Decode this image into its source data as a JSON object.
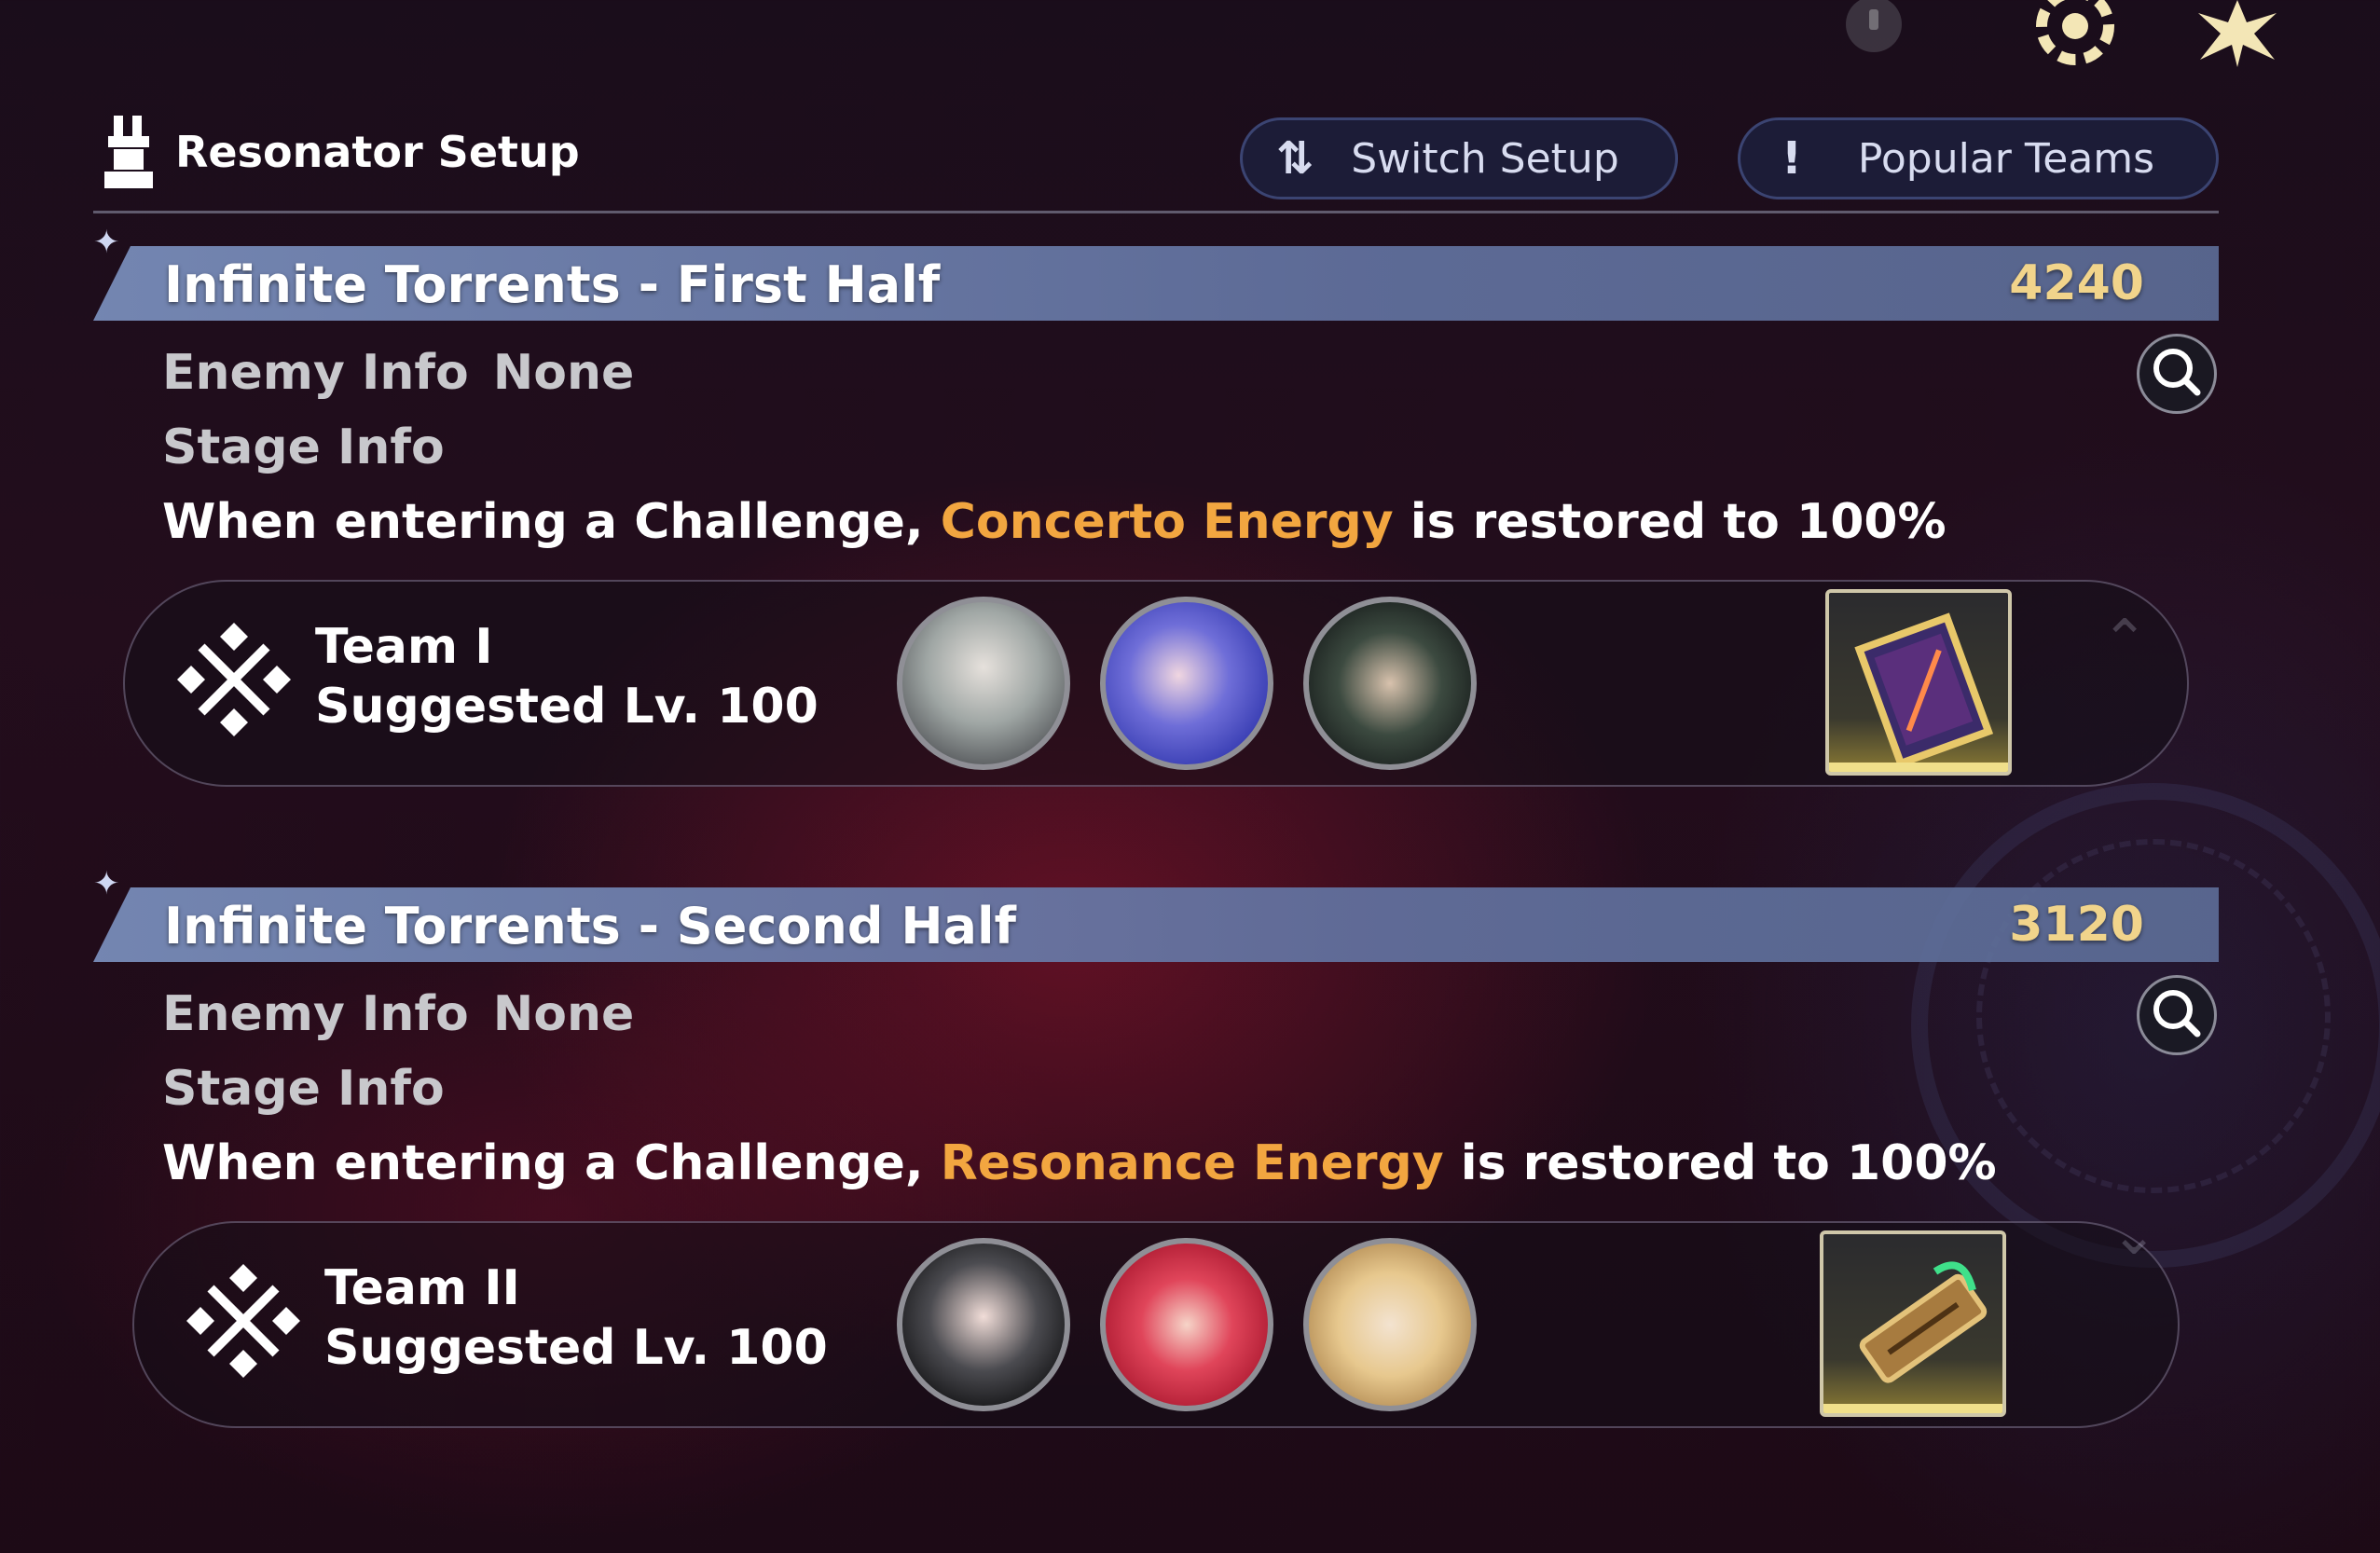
{
  "header": {
    "title": "Resonator Setup",
    "switch_setup_label": "Switch Setup",
    "popular_teams_label": "Popular Teams",
    "switch_icon": "⇅",
    "popular_icon": "!"
  },
  "top_icons": [
    "info-icon",
    "settings-gear-icon",
    "star-icon"
  ],
  "stages": [
    {
      "name": "Infinite Torrents - First Half",
      "score": "4240",
      "enemy_info_label": "Enemy Info",
      "enemy_info_value": "None",
      "stage_info_label": "Stage Info",
      "desc_prefix": "When entering a Challenge,",
      "desc_highlight": "Concerto Energy",
      "desc_suffix": "is restored to 100%",
      "team_name": "Team I",
      "team_level": "Suggested Lv. 100"
    },
    {
      "name": "Infinite Torrents - Second Half",
      "score": "3120",
      "enemy_info_label": "Enemy Info",
      "enemy_info_value": "None",
      "stage_info_label": "Stage Info",
      "desc_prefix": "When entering a Challenge,",
      "desc_highlight": "Resonance Energy",
      "desc_suffix": "is restored to 100%",
      "team_name": "Team II",
      "team_level": "Suggested Lv. 100"
    }
  ],
  "colors": {
    "highlight": "#f2a640",
    "score": "#f1d48b",
    "stage_bar": "#6f7faa"
  }
}
